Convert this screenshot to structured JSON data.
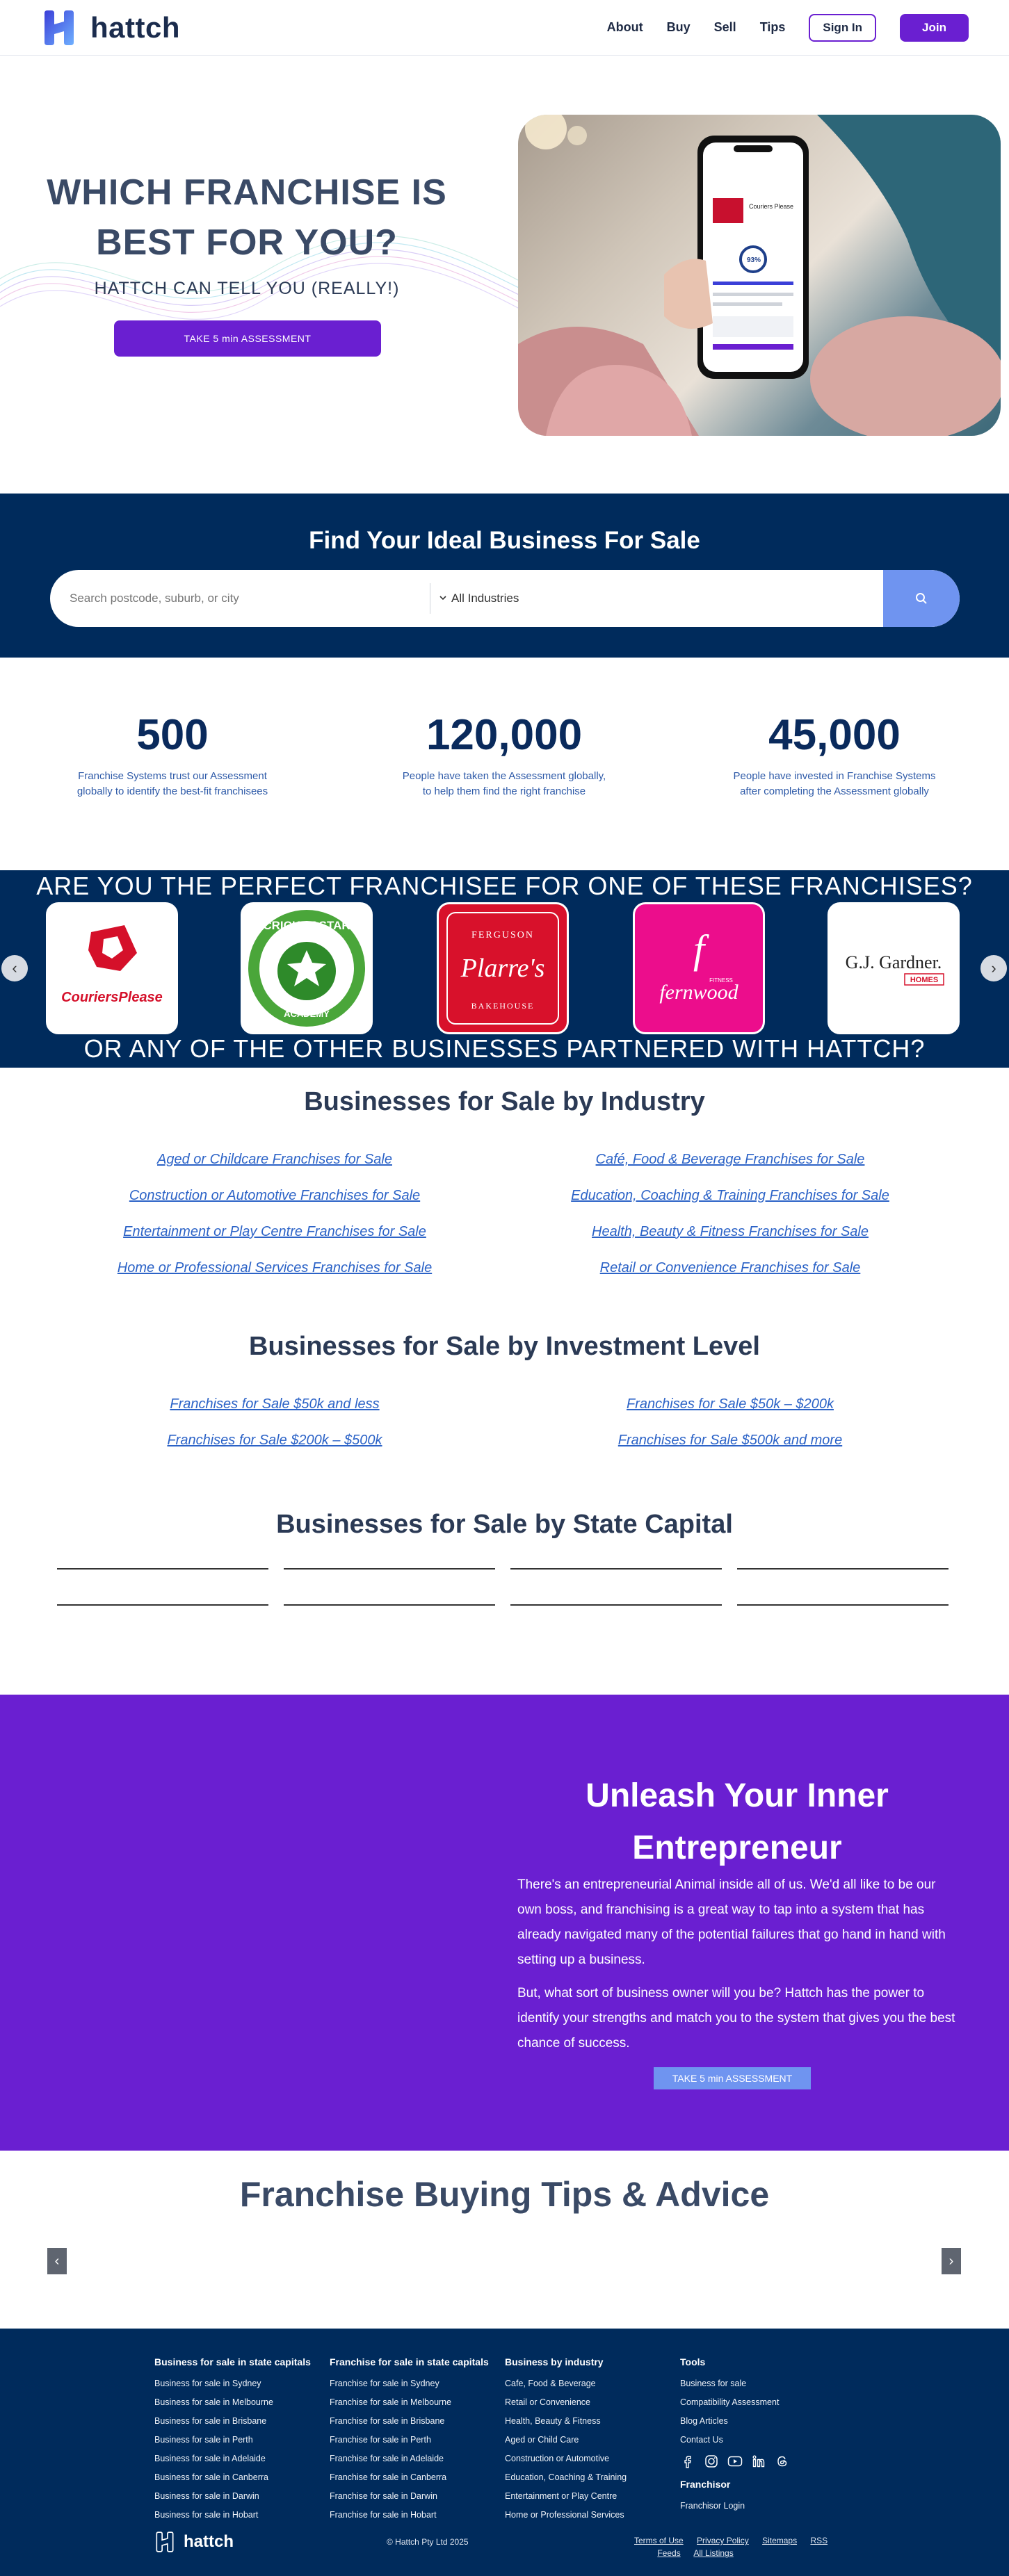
{
  "header": {
    "logo_text": "hattch",
    "nav": [
      "About",
      "Buy",
      "Sell",
      "Tips"
    ],
    "signin": "Sign In",
    "join": "Join"
  },
  "hero": {
    "title_line1": "WHICH FRANCHISE IS",
    "title_line2": "BEST FOR YOU?",
    "subtitle": "HATTCH CAN TELL YOU (REALLY!)",
    "cta": "TAKE 5 min ASSESSMENT",
    "phone_score": "93%",
    "phone_brand": "Couriers Please"
  },
  "search": {
    "title": "Find Your Ideal Business For Sale",
    "placeholder": "Search postcode, suburb, or city",
    "industry": "All Industries",
    "button_icon": "search-icon"
  },
  "stats": [
    {
      "number": "500",
      "desc": "Franchise Systems trust our Assessment globally to identify the best-fit franchisees"
    },
    {
      "number": "120,000",
      "desc": "People have taken the Assessment globally, to help them find the right franchise"
    },
    {
      "number": "45,000",
      "desc": "People have invested in Franchise Systems after completing the Assessment globally"
    }
  ],
  "brands": {
    "heading_top": "ARE YOU THE PERFECT FRANCHISEE FOR ONE OF THESE FRANCHISES?",
    "heading_bottom": "OR ANY OF THE OTHER BUSINESSES PARTNERED WITH HATTCH?",
    "logos": {
      "couriers": "CouriersPlease",
      "cricket_top": "CRICKET STAR",
      "cricket_bottom": "ACADEMY",
      "pl_top": "FERGUSON",
      "pl_main": "Plarre's",
      "pl_bottom": "BAKEHOUSE",
      "fern_small": "FITNESS",
      "fern_main": "fernwood",
      "gj_main": "G.J. Gardner.",
      "gj_sub": "HOMES"
    }
  },
  "industry": {
    "title": "Businesses for Sale by Industry",
    "left": [
      "Aged or Childcare Franchises for Sale",
      "Construction or Automotive Franchises for Sale",
      "Entertainment or Play Centre Franchises for Sale",
      "Home or Professional Services Franchises for Sale"
    ],
    "right": [
      "Café, Food & Beverage Franchises for Sale",
      "Education, Coaching & Training Franchises for Sale",
      "Health, Beauty & Fitness Franchises for Sale",
      "Retail or Convenience Franchises for Sale"
    ]
  },
  "investment": {
    "title": "Businesses for Sale by Investment Level",
    "left": [
      "Franchises for Sale $50k and less",
      "Franchises for Sale $200k – $500k"
    ],
    "right": [
      "Franchises for Sale $50k – $200k",
      "Franchises for Sale $500k and more"
    ]
  },
  "state": {
    "title": "Businesses for Sale by State Capital"
  },
  "entrepreneur": {
    "title_line1": "Unleash Your Inner",
    "title_line2": "Entrepreneur",
    "p1": "There's an entrepreneurial Animal inside all of us. We'd all like to be our own boss, and franchising is a great way to tap into a system that has already navigated many of the potential failures that go hand in hand with setting up a business.",
    "p2": "But, what sort of business owner will you be? Hattch has the power to identify your strengths and match you to the system that gives you the best chance of success.",
    "cta": "TAKE 5 min ASSESSMENT"
  },
  "tips": {
    "title": "Franchise Buying Tips & Advice",
    "prev": "‹",
    "next": "›"
  },
  "footer": {
    "col1": {
      "title": "Business for sale in state capitals",
      "items": [
        "Business for sale in Sydney",
        "Business for sale in Melbourne",
        "Business for sale in Brisbane",
        "Business for sale in Perth",
        "Business for sale in Adelaide",
        "Business for sale in Canberra",
        "Business for sale in Darwin",
        "Business for sale in Hobart"
      ]
    },
    "col2": {
      "title": "Franchise for sale in state capitals",
      "items": [
        "Franchise for sale in Sydney",
        "Franchise for sale in Melbourne",
        "Franchise for sale in Brisbane",
        "Franchise for sale in Perth",
        "Franchise for sale in Adelaide",
        "Franchise for sale in Canberra",
        "Franchise for sale in Darwin",
        "Franchise for sale in Hobart"
      ]
    },
    "col3": {
      "title": "Business by industry",
      "items": [
        "Cafe, Food & Beverage",
        "Retail or Convenience",
        "Health, Beauty & Fitness",
        "Aged or Child Care",
        "Construction or Automotive",
        "Education, Coaching & Training",
        "Entertainment or Play Centre",
        "Home or Professional Services"
      ]
    },
    "col4": {
      "title": "Tools",
      "items": [
        "Business for sale",
        "Compatibility Assessment",
        "Blog Articles",
        "Contact Us"
      ],
      "franchisor_title": "Franchisor",
      "franchisor_login": "Franchisor Login",
      "social_icons": [
        "facebook-icon",
        "instagram-icon",
        "youtube-icon",
        "linkedin-icon",
        "threads-icon"
      ]
    },
    "logo_text": "hattch",
    "copyright": "© Hattch Pty Ltd 2025",
    "links": [
      "Terms of Use",
      "Privacy Policy",
      "Sitemaps",
      "RSS",
      "Feeds",
      "All Listings"
    ]
  },
  "colors": {
    "navy": "#002b5c",
    "purple": "#6a1fd1",
    "periwinkle": "#6f94f0",
    "link_blue": "#2c63c7"
  }
}
